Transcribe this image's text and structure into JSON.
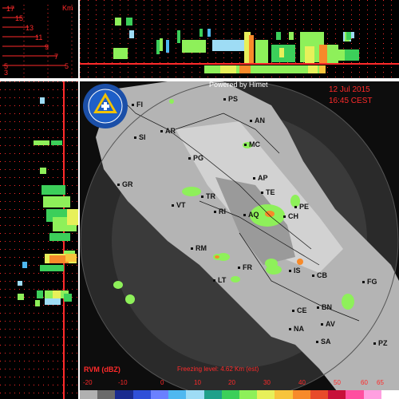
{
  "header": {
    "powered_by": "Powered by Himet",
    "date": "12 Jul 2015",
    "time": "16:45 CEST"
  },
  "altitude_axis": {
    "unit": "Km",
    "ticks": [
      "17",
      "15",
      "13",
      "11",
      "9",
      "7",
      "5",
      "3"
    ]
  },
  "product": {
    "name": "RVM (dBZ)",
    "freezing_level": "Freezing level: 4.62 Km (est)"
  },
  "colorbar": {
    "tick_labels": [
      "-20",
      "-10",
      "0",
      "10",
      "20",
      "30",
      "40",
      "50",
      "60",
      "65"
    ],
    "colors": [
      "#b0b0b0",
      "#6a6a6a",
      "#1a2b8f",
      "#2f4fd8",
      "#6a80ff",
      "#4fb8f0",
      "#9edcf5",
      "#1fa08a",
      "#3ccf5a",
      "#8ef05a",
      "#e7f05a",
      "#f7c43c",
      "#f78a2a",
      "#e84a2a",
      "#c8103a",
      "#ff4fa0",
      "#ff9fe0",
      "#ffffff"
    ]
  },
  "map": {
    "cities": [
      {
        "name": "PS"
      },
      {
        "name": "FI"
      },
      {
        "name": "AN"
      },
      {
        "name": "SI"
      },
      {
        "name": "AR"
      },
      {
        "name": "MC"
      },
      {
        "name": "PG"
      },
      {
        "name": "GR"
      },
      {
        "name": "AP"
      },
      {
        "name": "TE"
      },
      {
        "name": "TR"
      },
      {
        "name": "VT"
      },
      {
        "name": "RI"
      },
      {
        "name": "AQ"
      },
      {
        "name": "PE"
      },
      {
        "name": "CH"
      },
      {
        "name": "RM"
      },
      {
        "name": "FR"
      },
      {
        "name": "IS"
      },
      {
        "name": "CB"
      },
      {
        "name": "FG"
      },
      {
        "name": "LT"
      },
      {
        "name": "CE"
      },
      {
        "name": "BN"
      },
      {
        "name": "AV"
      },
      {
        "name": "NA"
      },
      {
        "name": "SA"
      },
      {
        "name": "PZ"
      }
    ]
  },
  "accent_color": "#ff2a2a"
}
